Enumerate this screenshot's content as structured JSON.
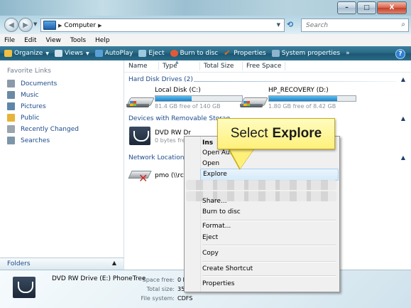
{
  "window": {
    "minimize_label": "–",
    "maximize_label": "□",
    "close_label": "X"
  },
  "address": {
    "path": [
      "Computer"
    ],
    "search_placeholder": "Search"
  },
  "menubar": [
    "File",
    "Edit",
    "View",
    "Tools",
    "Help"
  ],
  "toolbar": [
    {
      "label": "Organize",
      "dropdown": true,
      "icon": "organize-icon",
      "color": "#f0c040"
    },
    {
      "label": "Views",
      "dropdown": true,
      "icon": "views-icon",
      "color": "#cfe2ee"
    },
    {
      "label": "AutoPlay",
      "dropdown": false,
      "icon": "autoplay-icon",
      "color": "#5aa0d8"
    },
    {
      "label": "Eject",
      "dropdown": false,
      "icon": "eject-icon",
      "color": "#9ec8e0"
    },
    {
      "label": "Burn to disc",
      "dropdown": false,
      "icon": "burn-icon",
      "color": "#e05a3a"
    },
    {
      "label": "Properties",
      "dropdown": false,
      "icon": "checkmark-icon",
      "color": "#e86a1c"
    },
    {
      "label": "System properties",
      "dropdown": false,
      "icon": "system-icon",
      "color": "#8fb4d0"
    },
    {
      "label": "»",
      "dropdown": false,
      "icon": "",
      "color": ""
    }
  ],
  "favorites": {
    "heading": "Favorite Links",
    "items": [
      {
        "label": "Documents",
        "icon": "documents-icon",
        "color": "#8a9aa8"
      },
      {
        "label": "Music",
        "icon": "music-icon",
        "color": "#6c8aa5"
      },
      {
        "label": "Pictures",
        "icon": "pictures-icon",
        "color": "#5e86a8"
      },
      {
        "label": "Public",
        "icon": "folder-icon",
        "color": "#e7b43a"
      },
      {
        "label": "Recently Changed",
        "icon": "recent-icon",
        "color": "#9aa5ae"
      },
      {
        "label": "Searches",
        "icon": "searches-icon",
        "color": "#7d95a8"
      }
    ]
  },
  "folders_label": "Folders",
  "columns": [
    "Name",
    "Type",
    "Total Size",
    "Free Space"
  ],
  "groups": {
    "hdd": "Hard Disk Drives (2)",
    "removable": "Devices with Removable Storag",
    "network": "Network Location (2"
  },
  "drives": {
    "c": {
      "name": "Local Disk (C:)",
      "free": "81.4 GB free of 140 GB",
      "used_fraction": 0.42
    },
    "d": {
      "name": "HP_RECOVERY (D:)",
      "free": "1.80 GB free of 8.42 GB",
      "used_fraction": 0.79
    },
    "dvd": {
      "name": "DVD RW Dr",
      "free": "0 bytes free"
    },
    "net": {
      "name": "pmo (\\\\rch"
    }
  },
  "details": {
    "title": "DVD RW Drive (E:) PhoneTree",
    "rows": [
      {
        "label": "Space free:",
        "value": "0 b"
      },
      {
        "label": "Total size:",
        "value": "35"
      },
      {
        "label": "File system:",
        "value": "CDFS"
      }
    ]
  },
  "context_menu": {
    "items": {
      "install": "Ins",
      "open_autoplay": "Open AutoPlay",
      "open": "Open",
      "explore": "Explore",
      "share": "Share...",
      "burn": "Burn to disc",
      "format": "Format...",
      "eject": "Eject",
      "copy": "Copy",
      "shortcut": "Create Shortcut",
      "properties": "Properties"
    }
  },
  "callout": {
    "prefix": "Select",
    "emphasis": "Explore"
  }
}
